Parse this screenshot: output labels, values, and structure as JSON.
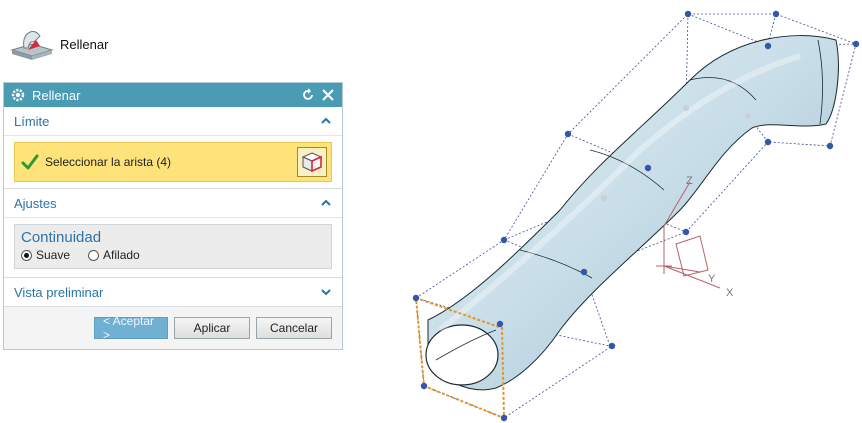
{
  "command": {
    "label": "Rellenar",
    "icon": "fill-surface-icon"
  },
  "dialog": {
    "title": "Rellenar",
    "reset_icon": "reset-icon",
    "close_icon": "close-icon",
    "limite": {
      "header": "Límite",
      "selection_label": "Seleccionar la arista (4)",
      "status_icon": "checkmark-icon",
      "select_button_icon": "cube-select-icon"
    },
    "ajustes": {
      "header": "Ajustes",
      "group_title": "Continuidad",
      "options": [
        {
          "label": "Suave",
          "selected": true
        },
        {
          "label": "Afilado",
          "selected": false
        }
      ]
    },
    "preview": {
      "header": "Vista preliminar",
      "collapsed": true
    },
    "buttons": {
      "ok": "< Aceptar >",
      "apply": "Aplicar",
      "cancel": "Cancelar"
    }
  },
  "viewport": {
    "axis_labels": {
      "x": "X",
      "y": "Y",
      "z": "Z"
    }
  },
  "colors": {
    "titlebar": "#4a9cb4",
    "section_header_text": "#2b74a8",
    "selection_highlight": "#fde37a",
    "primary_button": "#6fb0d3",
    "control_point": "#3355aa",
    "tube_fill": "#cfe3ec"
  }
}
